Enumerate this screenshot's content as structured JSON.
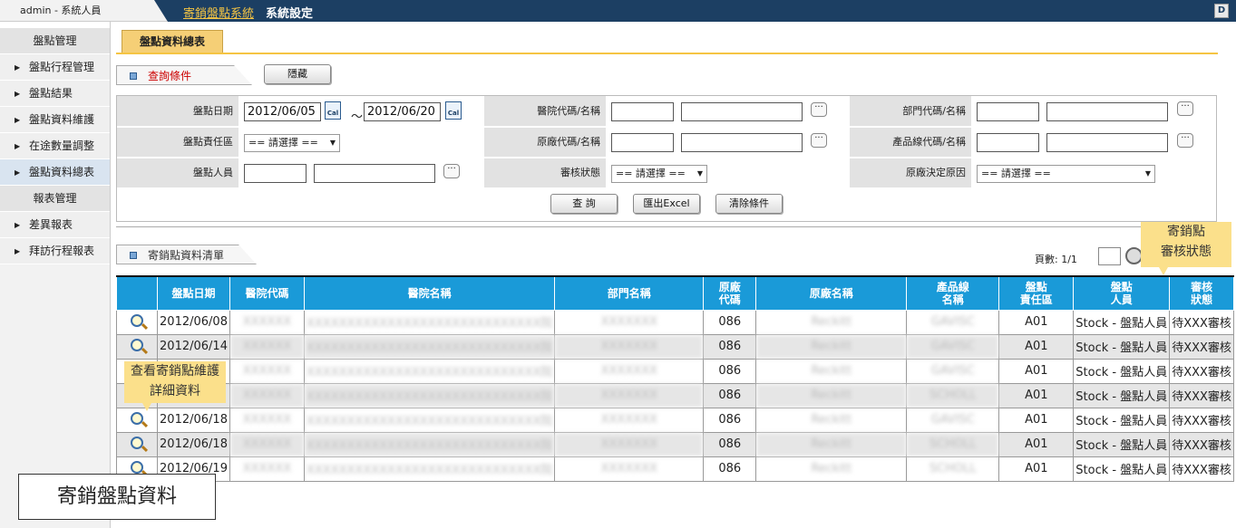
{
  "topbar": {
    "user": "admin - 系統人員",
    "system_name": "寄銷盤點系統",
    "settings": "系統設定",
    "exit_icon": "D"
  },
  "sidebar": {
    "group1": "盤點管理",
    "items1": [
      "盤點行程管理",
      "盤點結果",
      "盤點資料維護",
      "在途數量調整",
      "盤點資料總表"
    ],
    "group2": "報表管理",
    "items2": [
      "差異報表",
      "拜訪行程報表"
    ]
  },
  "tab": {
    "label": "盤點資料總表"
  },
  "query": {
    "header": "查詢條件",
    "hide_button": "隱藏",
    "date_label": "盤點日期",
    "date_from": "2012/06/05",
    "date_to": "2012/06/20",
    "cal_label": "Cal",
    "tilde": "～",
    "hospital_label": "醫院代碼/名稱",
    "dept_label": "部門代碼/名稱",
    "area_label": "盤點責任區",
    "area_value": "== 請選擇 ==",
    "vendor_label": "原廠代碼/名稱",
    "productline_label": "產品線代碼/名稱",
    "staff_label": "盤點人員",
    "review_label": "審核狀態",
    "review_value": "== 請選擇 ==",
    "reason_label": "原廠決定原因",
    "reason_value": "== 請選擇 ==",
    "dots": "···",
    "search_button": "查 詢",
    "export_button": "匯出Excel",
    "clear_button": "清除條件"
  },
  "list": {
    "header": "寄銷點資料清單",
    "pager": "頁數: 1/1",
    "columns": [
      "",
      "盤點日期",
      "醫院代碼",
      "醫院名稱",
      "部門名稱",
      "原廠\n代碼",
      "原廠名稱",
      "產品線\n名稱",
      "盤點\n責任區",
      "盤點\n人員",
      "審核\n狀態"
    ],
    "rows": [
      {
        "date": "2012/06/08",
        "hcode": "XXXXXX",
        "hname": "XXXXXXXXXXXXXXXXXXXXXXXXXXXXX院",
        "dept": "XXXXXXX",
        "vcode": "086",
        "vname": "Reckitt",
        "pline": "GAVISC",
        "area": "A01",
        "staff": "Stock - 盤點人員",
        "status": "待XXX審核"
      },
      {
        "date": "2012/06/14",
        "hcode": "XXXXXX",
        "hname": "XXXXXXXXXXXXXXXXXXXXXXXXXXXXX院",
        "dept": "XXXXXXX",
        "vcode": "086",
        "vname": "Reckitt",
        "pline": "GAVISC",
        "area": "A01",
        "staff": "Stock - 盤點人員",
        "status": "待XXX審核"
      },
      {
        "date": "",
        "hcode": "XXXXXX",
        "hname": "XXXXXXXXXXXXXXXXXXXXXXXXXXXXX院",
        "dept": "XXXXXXX",
        "vcode": "086",
        "vname": "Reckitt",
        "pline": "GAVISC",
        "area": "A01",
        "staff": "Stock - 盤點人員",
        "status": "待XXX審核"
      },
      {
        "date": "",
        "hcode": "XXXXXX",
        "hname": "XXXXXXXXXXXXXXXXXXXXXXXXXXXXX院",
        "dept": "XXXXXXX",
        "vcode": "086",
        "vname": "Reckitt",
        "pline": "SCHOLL",
        "area": "A01",
        "staff": "Stock - 盤點人員",
        "status": "待XXX審核"
      },
      {
        "date": "2012/06/18",
        "hcode": "XXXXXX",
        "hname": "XXXXXXXXXXXXXXXXXXXXXXXXXXXXX院",
        "dept": "XXXXXXX",
        "vcode": "086",
        "vname": "Reckitt",
        "pline": "GAVISC",
        "area": "A01",
        "staff": "Stock - 盤點人員",
        "status": "待XXX審核"
      },
      {
        "date": "2012/06/18",
        "hcode": "XXXXXX",
        "hname": "XXXXXXXXXXXXXXXXXXXXXXXXXXXXX院",
        "dept": "XXXXXXX",
        "vcode": "086",
        "vname": "Reckitt",
        "pline": "SCHOLL",
        "area": "A01",
        "staff": "Stock - 盤點人員",
        "status": "待XXX審核"
      },
      {
        "date": "2012/06/19",
        "hcode": "XXXXXX",
        "hname": "XXXXXXXXXXXXXXXXXXXXXXXXXXXXX院",
        "dept": "XXXXXXX",
        "vcode": "086",
        "vname": "Reckitt",
        "pline": "SCHOLL",
        "area": "A01",
        "staff": "Stock - 盤點人員",
        "status": "待XXX審核"
      }
    ]
  },
  "callouts": {
    "status": "寄銷點\n審核狀態",
    "detail": "查看寄銷點維護\n詳細資料"
  },
  "caption": "寄銷盤點資料"
}
